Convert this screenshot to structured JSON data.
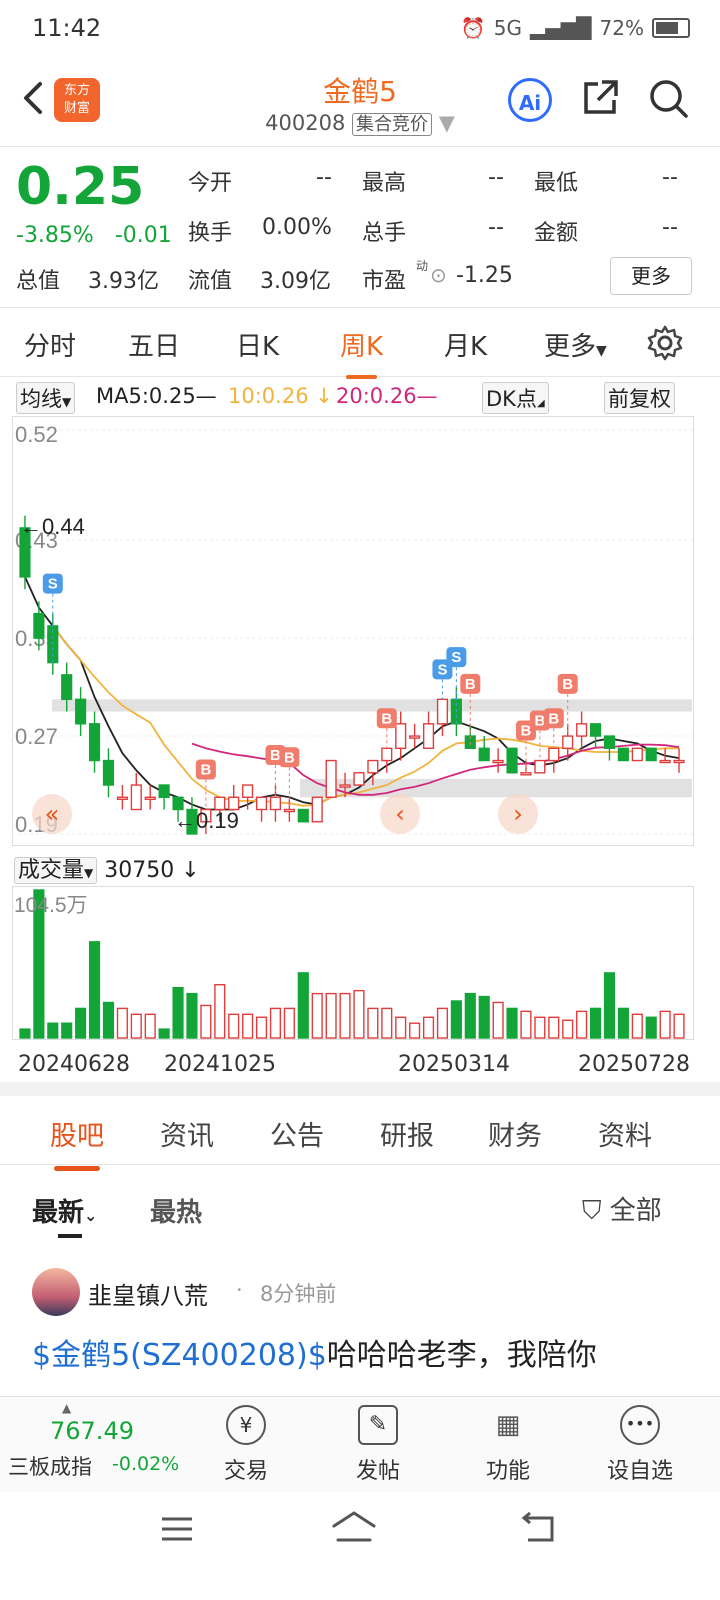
{
  "status_bar": {
    "time": "11:42",
    "battery": "72%",
    "network": "5G"
  },
  "header": {
    "stock_name": "金鹤5",
    "code": "400208",
    "tag": "集合竞价",
    "logo_text_1": "东方",
    "logo_text_2": "财富"
  },
  "quote": {
    "price": "0.25",
    "change_pct": "-3.85%",
    "change": "-0.01",
    "open_label": "今开",
    "open": "--",
    "high_label": "最高",
    "high": "--",
    "low_label": "最低",
    "low": "--",
    "turnover_label": "换手",
    "turnover": "0.00%",
    "volume_label": "总手",
    "volume": "--",
    "amount_label": "金额",
    "amount": "--",
    "mktcap_label": "总值",
    "mktcap": "3.93亿",
    "float_label": "流值",
    "float": "3.09亿",
    "pe_label": "市盈",
    "pe_sup": "动",
    "pe": "-1.25",
    "more": "更多"
  },
  "chart_tabs": [
    "分时",
    "五日",
    "日K",
    "周K",
    "月K",
    "更多"
  ],
  "active_tab": "周K",
  "ma_bar": {
    "selector": "均线",
    "ma5": "MA5:0.25—",
    "ma10": "10:0.26 ↓",
    "ma20": "20:0.26—",
    "dk": "DK点",
    "adjust": "前复权"
  },
  "colors": {
    "up": "#e23b3b",
    "down": "#13a538",
    "accent": "#f06a22",
    "ma5": "#222222",
    "ma10": "#f2b33d",
    "ma20": "#d2267d"
  },
  "chart_data": {
    "type": "candlestick",
    "y_ticks": [
      "0.52",
      "0.43",
      "0.35",
      "0.27",
      "0.19"
    ],
    "ylim": [
      0.19,
      0.52
    ],
    "max_label": "←0.44",
    "min_label": "←0.19",
    "candles": [
      {
        "o": 0.44,
        "c": 0.4,
        "h": 0.45,
        "l": 0.39
      },
      {
        "o": 0.37,
        "c": 0.35,
        "h": 0.38,
        "l": 0.34
      },
      {
        "o": 0.36,
        "c": 0.33,
        "h": 0.37,
        "l": 0.32
      },
      {
        "o": 0.32,
        "c": 0.3,
        "h": 0.33,
        "l": 0.29
      },
      {
        "o": 0.3,
        "c": 0.28,
        "h": 0.31,
        "l": 0.27
      },
      {
        "o": 0.28,
        "c": 0.25,
        "h": 0.29,
        "l": 0.24
      },
      {
        "o": 0.25,
        "c": 0.23,
        "h": 0.26,
        "l": 0.22
      },
      {
        "o": 0.22,
        "c": 0.22,
        "h": 0.23,
        "l": 0.21
      },
      {
        "o": 0.21,
        "c": 0.23,
        "h": 0.24,
        "l": 0.21
      },
      {
        "o": 0.22,
        "c": 0.22,
        "h": 0.23,
        "l": 0.21
      },
      {
        "o": 0.23,
        "c": 0.22,
        "h": 0.23,
        "l": 0.21
      },
      {
        "o": 0.22,
        "c": 0.21,
        "h": 0.22,
        "l": 0.2
      },
      {
        "o": 0.21,
        "c": 0.19,
        "h": 0.22,
        "l": 0.19
      },
      {
        "o": 0.2,
        "c": 0.21,
        "h": 0.21,
        "l": 0.19
      },
      {
        "o": 0.21,
        "c": 0.22,
        "h": 0.22,
        "l": 0.2
      },
      {
        "o": 0.21,
        "c": 0.22,
        "h": 0.23,
        "l": 0.21
      },
      {
        "o": 0.22,
        "c": 0.23,
        "h": 0.23,
        "l": 0.21
      },
      {
        "o": 0.21,
        "c": 0.22,
        "h": 0.22,
        "l": 0.2
      },
      {
        "o": 0.21,
        "c": 0.22,
        "h": 0.23,
        "l": 0.2
      },
      {
        "o": 0.21,
        "c": 0.21,
        "h": 0.22,
        "l": 0.2
      },
      {
        "o": 0.21,
        "c": 0.2,
        "h": 0.21,
        "l": 0.2
      },
      {
        "o": 0.2,
        "c": 0.22,
        "h": 0.22,
        "l": 0.2
      },
      {
        "o": 0.22,
        "c": 0.25,
        "h": 0.25,
        "l": 0.22
      },
      {
        "o": 0.23,
        "c": 0.23,
        "h": 0.24,
        "l": 0.22
      },
      {
        "o": 0.23,
        "c": 0.24,
        "h": 0.24,
        "l": 0.23
      },
      {
        "o": 0.24,
        "c": 0.25,
        "h": 0.25,
        "l": 0.23
      },
      {
        "o": 0.25,
        "c": 0.26,
        "h": 0.26,
        "l": 0.24
      },
      {
        "o": 0.26,
        "c": 0.28,
        "h": 0.29,
        "l": 0.25
      },
      {
        "o": 0.27,
        "c": 0.27,
        "h": 0.28,
        "l": 0.26
      },
      {
        "o": 0.26,
        "c": 0.28,
        "h": 0.29,
        "l": 0.26
      },
      {
        "o": 0.28,
        "c": 0.3,
        "h": 0.3,
        "l": 0.27
      },
      {
        "o": 0.3,
        "c": 0.28,
        "h": 0.31,
        "l": 0.27
      },
      {
        "o": 0.27,
        "c": 0.26,
        "h": 0.28,
        "l": 0.26
      },
      {
        "o": 0.26,
        "c": 0.25,
        "h": 0.27,
        "l": 0.25
      },
      {
        "o": 0.25,
        "c": 0.25,
        "h": 0.26,
        "l": 0.24
      },
      {
        "o": 0.26,
        "c": 0.24,
        "h": 0.26,
        "l": 0.24
      },
      {
        "o": 0.24,
        "c": 0.24,
        "h": 0.25,
        "l": 0.24
      },
      {
        "o": 0.24,
        "c": 0.25,
        "h": 0.25,
        "l": 0.24
      },
      {
        "o": 0.25,
        "c": 0.26,
        "h": 0.26,
        "l": 0.24
      },
      {
        "o": 0.26,
        "c": 0.27,
        "h": 0.28,
        "l": 0.25
      },
      {
        "o": 0.27,
        "c": 0.28,
        "h": 0.29,
        "l": 0.26
      },
      {
        "o": 0.28,
        "c": 0.27,
        "h": 0.28,
        "l": 0.26
      },
      {
        "o": 0.27,
        "c": 0.26,
        "h": 0.27,
        "l": 0.25
      },
      {
        "o": 0.26,
        "c": 0.25,
        "h": 0.26,
        "l": 0.25
      },
      {
        "o": 0.25,
        "c": 0.26,
        "h": 0.26,
        "l": 0.25
      },
      {
        "o": 0.26,
        "c": 0.25,
        "h": 0.26,
        "l": 0.25
      },
      {
        "o": 0.25,
        "c": 0.25,
        "h": 0.26,
        "l": 0.25
      },
      {
        "o": 0.25,
        "c": 0.25,
        "h": 0.26,
        "l": 0.24
      }
    ],
    "badges": [
      {
        "label": "S",
        "i": 2,
        "type": "sell"
      },
      {
        "label": "B",
        "i": 13,
        "type": "buy"
      },
      {
        "label": "B",
        "i": 18,
        "type": "buy"
      },
      {
        "label": "B",
        "i": 19,
        "type": "buy"
      },
      {
        "label": "B",
        "i": 26,
        "type": "buy"
      },
      {
        "label": "S",
        "i": 30,
        "type": "sell"
      },
      {
        "label": "S",
        "i": 31,
        "type": "sell"
      },
      {
        "label": "B",
        "i": 32,
        "type": "buy"
      },
      {
        "label": "B",
        "i": 36,
        "type": "buy"
      },
      {
        "label": "B",
        "i": 37,
        "type": "buy"
      },
      {
        "label": "B",
        "i": 38,
        "type": "buy"
      },
      {
        "label": "B",
        "i": 39,
        "type": "buy"
      }
    ],
    "gray_zones": [
      [
        0.29,
        0.3
      ],
      [
        0.22,
        0.235
      ]
    ]
  },
  "volume": {
    "selector": "成交量",
    "value": "30750 ↓",
    "max_label": "104.5万",
    "bars": [
      0.06,
      1.0,
      0.1,
      0.1,
      0.2,
      0.65,
      0.24,
      0.2,
      0.16,
      0.16,
      0.06,
      0.34,
      0.3,
      0.22,
      0.36,
      0.16,
      0.16,
      0.14,
      0.2,
      0.2,
      0.44,
      0.3,
      0.3,
      0.3,
      0.32,
      0.2,
      0.2,
      0.14,
      0.1,
      0.14,
      0.2,
      0.25,
      0.3,
      0.28,
      0.24,
      0.2,
      0.18,
      0.14,
      0.14,
      0.12,
      0.18,
      0.2,
      0.44,
      0.2,
      0.16,
      0.14,
      0.18,
      0.16
    ],
    "dates": [
      "20240628",
      "20241025",
      "20250314",
      "20250728"
    ]
  },
  "content_tabs": [
    "股吧",
    "资讯",
    "公告",
    "研报",
    "财务",
    "资料"
  ],
  "filter": {
    "latest": "最新",
    "hot": "最热",
    "all": "全部"
  },
  "post": {
    "user": "韭皇镇八荒",
    "time": "8分钟前",
    "link": "$金鹤5(SZ400208)$",
    "text": "哈哈哈老李，我陪你"
  },
  "bottom_nav": {
    "index_value": "767.49",
    "index_name": "三板成指",
    "index_change": "-0.02%",
    "items": [
      "交易",
      "发帖",
      "功能",
      "设自选"
    ]
  }
}
